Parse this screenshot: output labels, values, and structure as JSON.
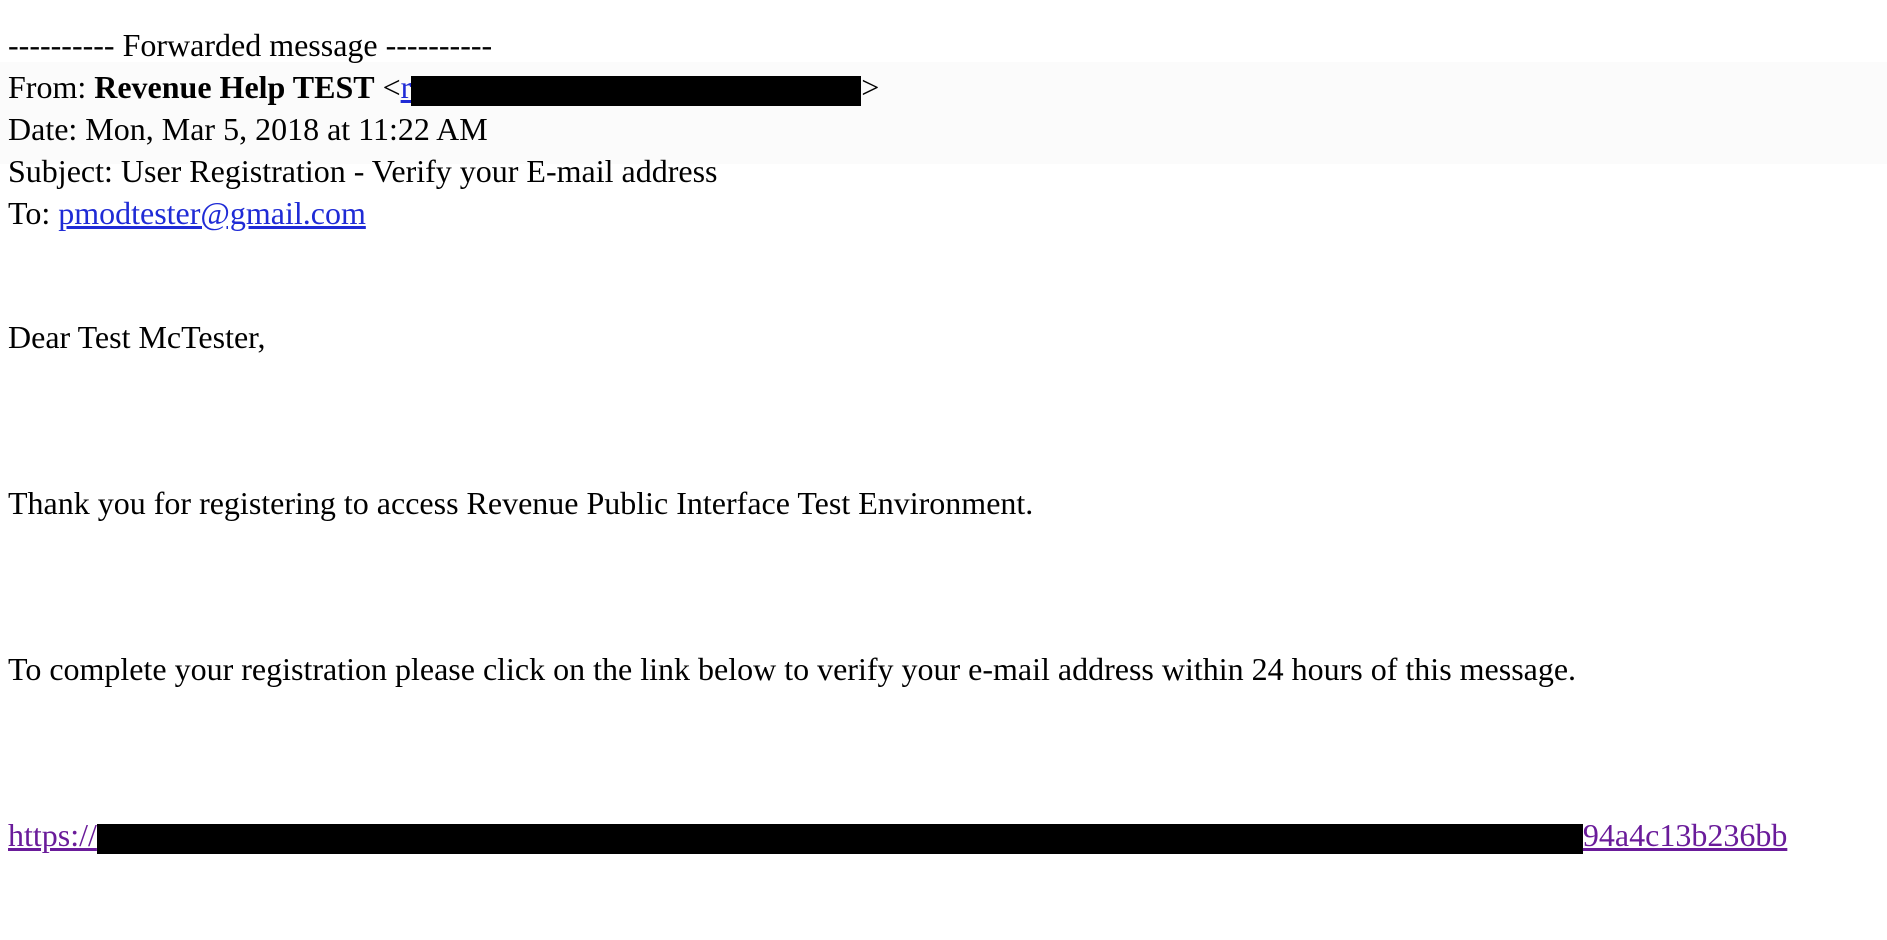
{
  "header": {
    "forwarded_label": "---------- Forwarded message ----------",
    "from_label": "From: ",
    "from_name": "Revenue Help TEST",
    "from_lt": "<",
    "from_email_prefix": "r",
    "from_gt": ">",
    "date_label": "Date: ",
    "date_value": "Mon, Mar 5, 2018 at 11:22 AM",
    "subject_label": "Subject: ",
    "subject_value": "User Registration - Verify your E-mail address",
    "to_label": "To: ",
    "to_email": "pmodtester@gmail.com"
  },
  "body": {
    "greeting": "Dear Test McTester,",
    "thanks": "Thank you for registering to access Revenue Public Interface Test Environment.",
    "instructions": "To complete your registration please click on the link below to verify your e-mail address within 24 hours of this message.",
    "link_prefix": "https://",
    "link_suffix": "94a4c13b236bb"
  },
  "colors": {
    "link": "#1f2bd6",
    "visited_link": "#6a1b9a",
    "redaction": "#000000",
    "header_band": "#fbfbfb"
  }
}
